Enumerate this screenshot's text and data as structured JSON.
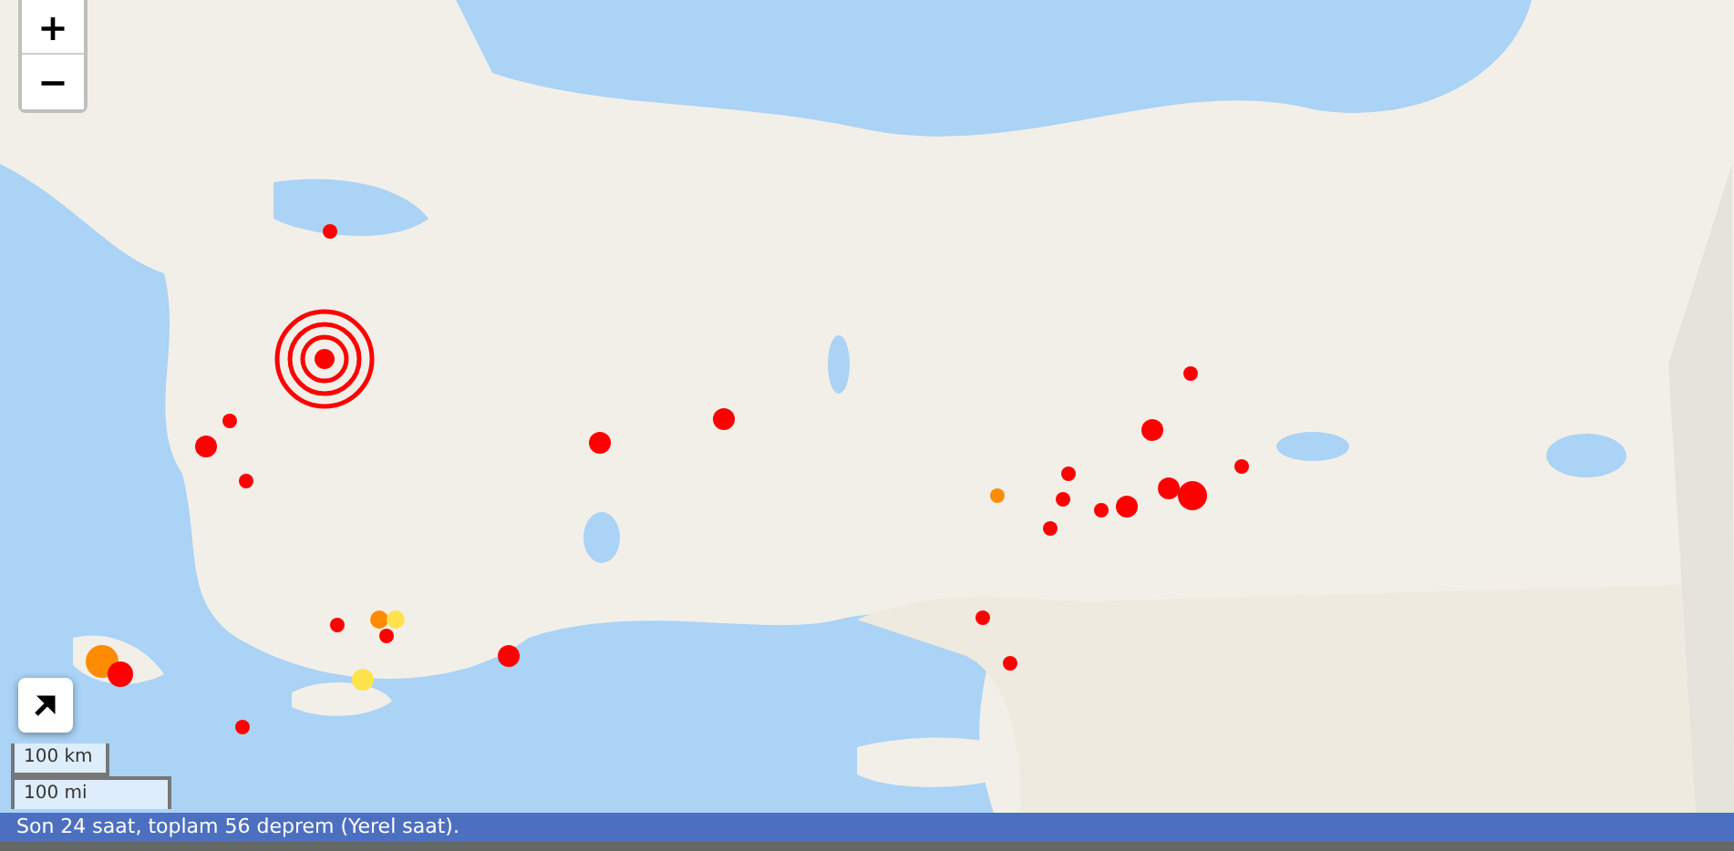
{
  "map": {
    "zoom_in": "+",
    "zoom_out": "−",
    "scale": [
      "100 km",
      "100 mi"
    ],
    "latest_quake": {
      "color": "#ff0000"
    },
    "quakes": [
      {
        "color": "#ff0000"
      },
      {
        "color": "#ff0000"
      },
      {
        "color": "#ff0000"
      },
      {
        "color": "#ff0000"
      },
      {
        "color": "#ff0000"
      },
      {
        "color": "#ff0000"
      },
      {
        "color": "#ff0000"
      },
      {
        "color": "#ff0000"
      },
      {
        "color": "#ff8c00"
      },
      {
        "color": "#ffe34d"
      },
      {
        "color": "#ff0000"
      },
      {
        "color": "#ffe34d"
      },
      {
        "color": "#ff0000"
      },
      {
        "color": "#ff8c00"
      },
      {
        "color": "#ff0000"
      },
      {
        "color": "#ff0000"
      },
      {
        "color": "#ff0000"
      },
      {
        "color": "#ff0000"
      },
      {
        "color": "#ff8c00"
      },
      {
        "color": "#ff0000"
      },
      {
        "color": "#ff0000"
      },
      {
        "color": "#ff0000"
      },
      {
        "color": "#ff0000"
      },
      {
        "color": "#ff0000"
      },
      {
        "color": "#ff0000"
      },
      {
        "color": "#ff0000"
      },
      {
        "color": "#ff0000"
      },
      {
        "color": "#ff0000"
      }
    ]
  },
  "status_bar": "Son 24 saat, toplam 56 deprem (Yerel saat)."
}
